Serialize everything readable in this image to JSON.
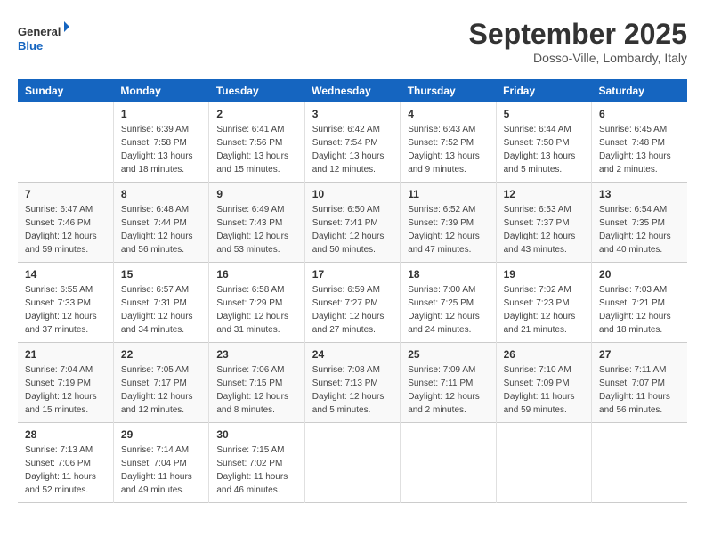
{
  "header": {
    "logo_general": "General",
    "logo_blue": "Blue",
    "month_title": "September 2025",
    "location": "Dosso-Ville, Lombardy, Italy"
  },
  "days_of_week": [
    "Sunday",
    "Monday",
    "Tuesday",
    "Wednesday",
    "Thursday",
    "Friday",
    "Saturday"
  ],
  "weeks": [
    [
      {
        "day": "",
        "info": ""
      },
      {
        "day": "1",
        "info": "Sunrise: 6:39 AM\nSunset: 7:58 PM\nDaylight: 13 hours\nand 18 minutes."
      },
      {
        "day": "2",
        "info": "Sunrise: 6:41 AM\nSunset: 7:56 PM\nDaylight: 13 hours\nand 15 minutes."
      },
      {
        "day": "3",
        "info": "Sunrise: 6:42 AM\nSunset: 7:54 PM\nDaylight: 13 hours\nand 12 minutes."
      },
      {
        "day": "4",
        "info": "Sunrise: 6:43 AM\nSunset: 7:52 PM\nDaylight: 13 hours\nand 9 minutes."
      },
      {
        "day": "5",
        "info": "Sunrise: 6:44 AM\nSunset: 7:50 PM\nDaylight: 13 hours\nand 5 minutes."
      },
      {
        "day": "6",
        "info": "Sunrise: 6:45 AM\nSunset: 7:48 PM\nDaylight: 13 hours\nand 2 minutes."
      }
    ],
    [
      {
        "day": "7",
        "info": "Sunrise: 6:47 AM\nSunset: 7:46 PM\nDaylight: 12 hours\nand 59 minutes."
      },
      {
        "day": "8",
        "info": "Sunrise: 6:48 AM\nSunset: 7:44 PM\nDaylight: 12 hours\nand 56 minutes."
      },
      {
        "day": "9",
        "info": "Sunrise: 6:49 AM\nSunset: 7:43 PM\nDaylight: 12 hours\nand 53 minutes."
      },
      {
        "day": "10",
        "info": "Sunrise: 6:50 AM\nSunset: 7:41 PM\nDaylight: 12 hours\nand 50 minutes."
      },
      {
        "day": "11",
        "info": "Sunrise: 6:52 AM\nSunset: 7:39 PM\nDaylight: 12 hours\nand 47 minutes."
      },
      {
        "day": "12",
        "info": "Sunrise: 6:53 AM\nSunset: 7:37 PM\nDaylight: 12 hours\nand 43 minutes."
      },
      {
        "day": "13",
        "info": "Sunrise: 6:54 AM\nSunset: 7:35 PM\nDaylight: 12 hours\nand 40 minutes."
      }
    ],
    [
      {
        "day": "14",
        "info": "Sunrise: 6:55 AM\nSunset: 7:33 PM\nDaylight: 12 hours\nand 37 minutes."
      },
      {
        "day": "15",
        "info": "Sunrise: 6:57 AM\nSunset: 7:31 PM\nDaylight: 12 hours\nand 34 minutes."
      },
      {
        "day": "16",
        "info": "Sunrise: 6:58 AM\nSunset: 7:29 PM\nDaylight: 12 hours\nand 31 minutes."
      },
      {
        "day": "17",
        "info": "Sunrise: 6:59 AM\nSunset: 7:27 PM\nDaylight: 12 hours\nand 27 minutes."
      },
      {
        "day": "18",
        "info": "Sunrise: 7:00 AM\nSunset: 7:25 PM\nDaylight: 12 hours\nand 24 minutes."
      },
      {
        "day": "19",
        "info": "Sunrise: 7:02 AM\nSunset: 7:23 PM\nDaylight: 12 hours\nand 21 minutes."
      },
      {
        "day": "20",
        "info": "Sunrise: 7:03 AM\nSunset: 7:21 PM\nDaylight: 12 hours\nand 18 minutes."
      }
    ],
    [
      {
        "day": "21",
        "info": "Sunrise: 7:04 AM\nSunset: 7:19 PM\nDaylight: 12 hours\nand 15 minutes."
      },
      {
        "day": "22",
        "info": "Sunrise: 7:05 AM\nSunset: 7:17 PM\nDaylight: 12 hours\nand 12 minutes."
      },
      {
        "day": "23",
        "info": "Sunrise: 7:06 AM\nSunset: 7:15 PM\nDaylight: 12 hours\nand 8 minutes."
      },
      {
        "day": "24",
        "info": "Sunrise: 7:08 AM\nSunset: 7:13 PM\nDaylight: 12 hours\nand 5 minutes."
      },
      {
        "day": "25",
        "info": "Sunrise: 7:09 AM\nSunset: 7:11 PM\nDaylight: 12 hours\nand 2 minutes."
      },
      {
        "day": "26",
        "info": "Sunrise: 7:10 AM\nSunset: 7:09 PM\nDaylight: 11 hours\nand 59 minutes."
      },
      {
        "day": "27",
        "info": "Sunrise: 7:11 AM\nSunset: 7:07 PM\nDaylight: 11 hours\nand 56 minutes."
      }
    ],
    [
      {
        "day": "28",
        "info": "Sunrise: 7:13 AM\nSunset: 7:06 PM\nDaylight: 11 hours\nand 52 minutes."
      },
      {
        "day": "29",
        "info": "Sunrise: 7:14 AM\nSunset: 7:04 PM\nDaylight: 11 hours\nand 49 minutes."
      },
      {
        "day": "30",
        "info": "Sunrise: 7:15 AM\nSunset: 7:02 PM\nDaylight: 11 hours\nand 46 minutes."
      },
      {
        "day": "",
        "info": ""
      },
      {
        "day": "",
        "info": ""
      },
      {
        "day": "",
        "info": ""
      },
      {
        "day": "",
        "info": ""
      }
    ]
  ]
}
